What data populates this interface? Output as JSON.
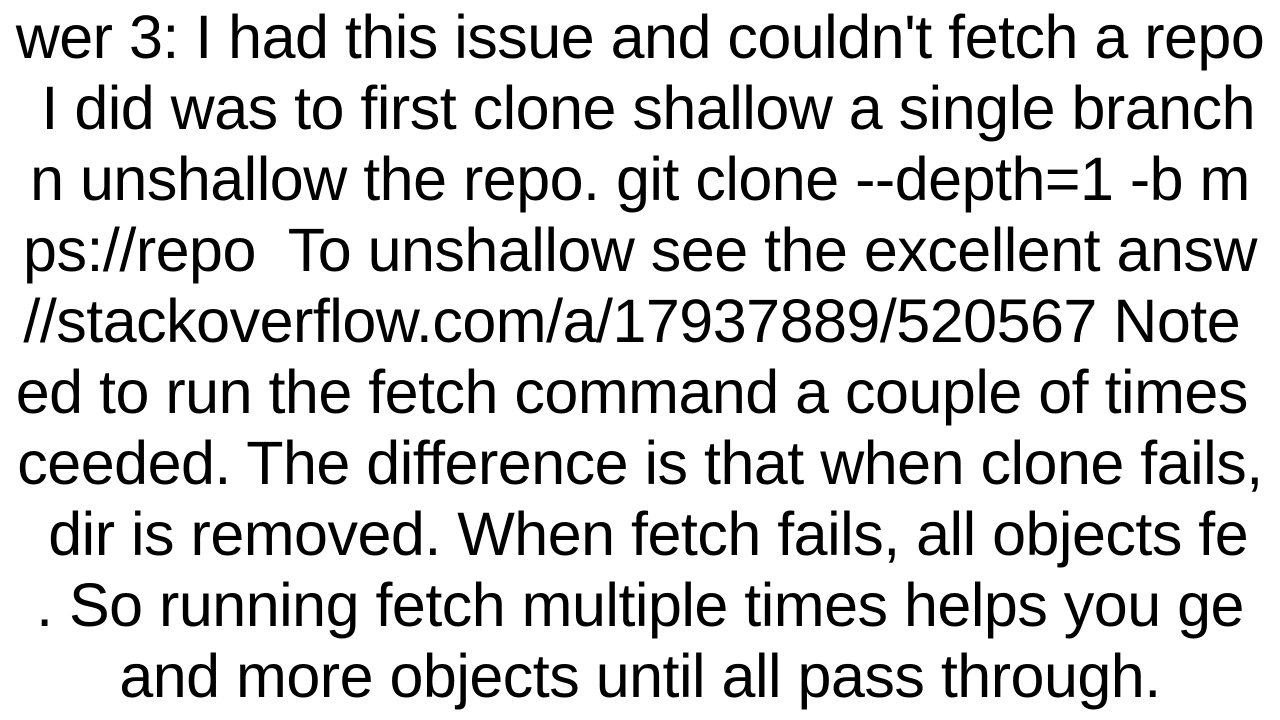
{
  "answer": {
    "lines": [
      "wer 3: I had this issue and couldn't fetch a repo",
      " I did was to first clone shallow a single branch",
      "n unshallow the repo. git clone --depth=1 -b m",
      "ps://repo  To unshallow see the excellent answ",
      "//stackoverflow.com/a/17937889/520567 Note ",
      "ed to run the fetch command a couple of times ",
      "ceeded. The difference is that when clone fails,",
      " dir is removed. When fetch fails, all objects fe",
      ". So running fetch multiple times helps you ge",
      "and more objects until all pass through."
    ]
  }
}
